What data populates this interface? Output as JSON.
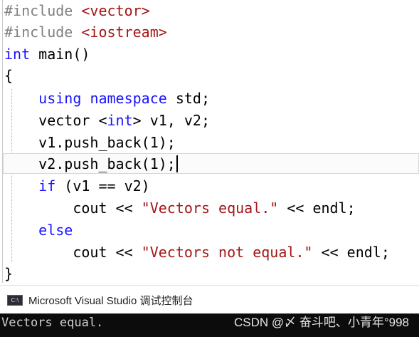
{
  "editor": {
    "lines": [
      {
        "tokens": [
          {
            "t": "#include ",
            "c": "pp"
          },
          {
            "t": "<vector>",
            "c": "str"
          }
        ]
      },
      {
        "tokens": [
          {
            "t": "#include ",
            "c": "pp"
          },
          {
            "t": "<iostream>",
            "c": "str"
          }
        ]
      },
      {
        "tokens": [
          {
            "t": "int",
            "c": "kw"
          },
          {
            "t": " main()",
            "c": ""
          }
        ]
      },
      {
        "tokens": [
          {
            "t": "{",
            "c": ""
          }
        ]
      },
      {
        "tokens": [
          {
            "t": "    ",
            "c": ""
          },
          {
            "t": "using",
            "c": "kw"
          },
          {
            "t": " ",
            "c": ""
          },
          {
            "t": "namespace",
            "c": "kw"
          },
          {
            "t": " std;",
            "c": ""
          }
        ]
      },
      {
        "tokens": [
          {
            "t": "    vector <",
            "c": ""
          },
          {
            "t": "int",
            "c": "kw"
          },
          {
            "t": "> v1, v2;",
            "c": ""
          }
        ]
      },
      {
        "tokens": [
          {
            "t": "    v1.push_back(1);",
            "c": ""
          }
        ]
      },
      {
        "tokens": [
          {
            "t": "    v2.push_back(1);",
            "c": ""
          }
        ],
        "caret": true
      },
      {
        "tokens": [
          {
            "t": "    ",
            "c": ""
          },
          {
            "t": "if",
            "c": "kw"
          },
          {
            "t": " (v1 == v2)",
            "c": ""
          }
        ]
      },
      {
        "tokens": [
          {
            "t": "        cout << ",
            "c": ""
          },
          {
            "t": "\"Vectors equal.\"",
            "c": "str"
          },
          {
            "t": " << endl;",
            "c": ""
          }
        ]
      },
      {
        "tokens": [
          {
            "t": "    ",
            "c": ""
          },
          {
            "t": "else",
            "c": "kw"
          }
        ]
      },
      {
        "tokens": [
          {
            "t": "        cout << ",
            "c": ""
          },
          {
            "t": "\"Vectors not equal.\"",
            "c": "str"
          },
          {
            "t": " << endl;",
            "c": ""
          }
        ]
      },
      {
        "tokens": [
          {
            "t": "}",
            "c": ""
          }
        ]
      }
    ]
  },
  "console": {
    "icon_label": "C:\\",
    "title": "Microsoft Visual Studio 调试控制台",
    "output": "Vectors equal.",
    "watermark": "CSDN @〆 奋斗吧、小青年°998"
  },
  "colors": {
    "keyword": "#1a14ff",
    "preprocessor": "#808080",
    "string": "#a31515",
    "console_bg": "#0c0c0c",
    "console_text": "#cccccc"
  },
  "icons": {
    "console": "console-app-icon"
  }
}
